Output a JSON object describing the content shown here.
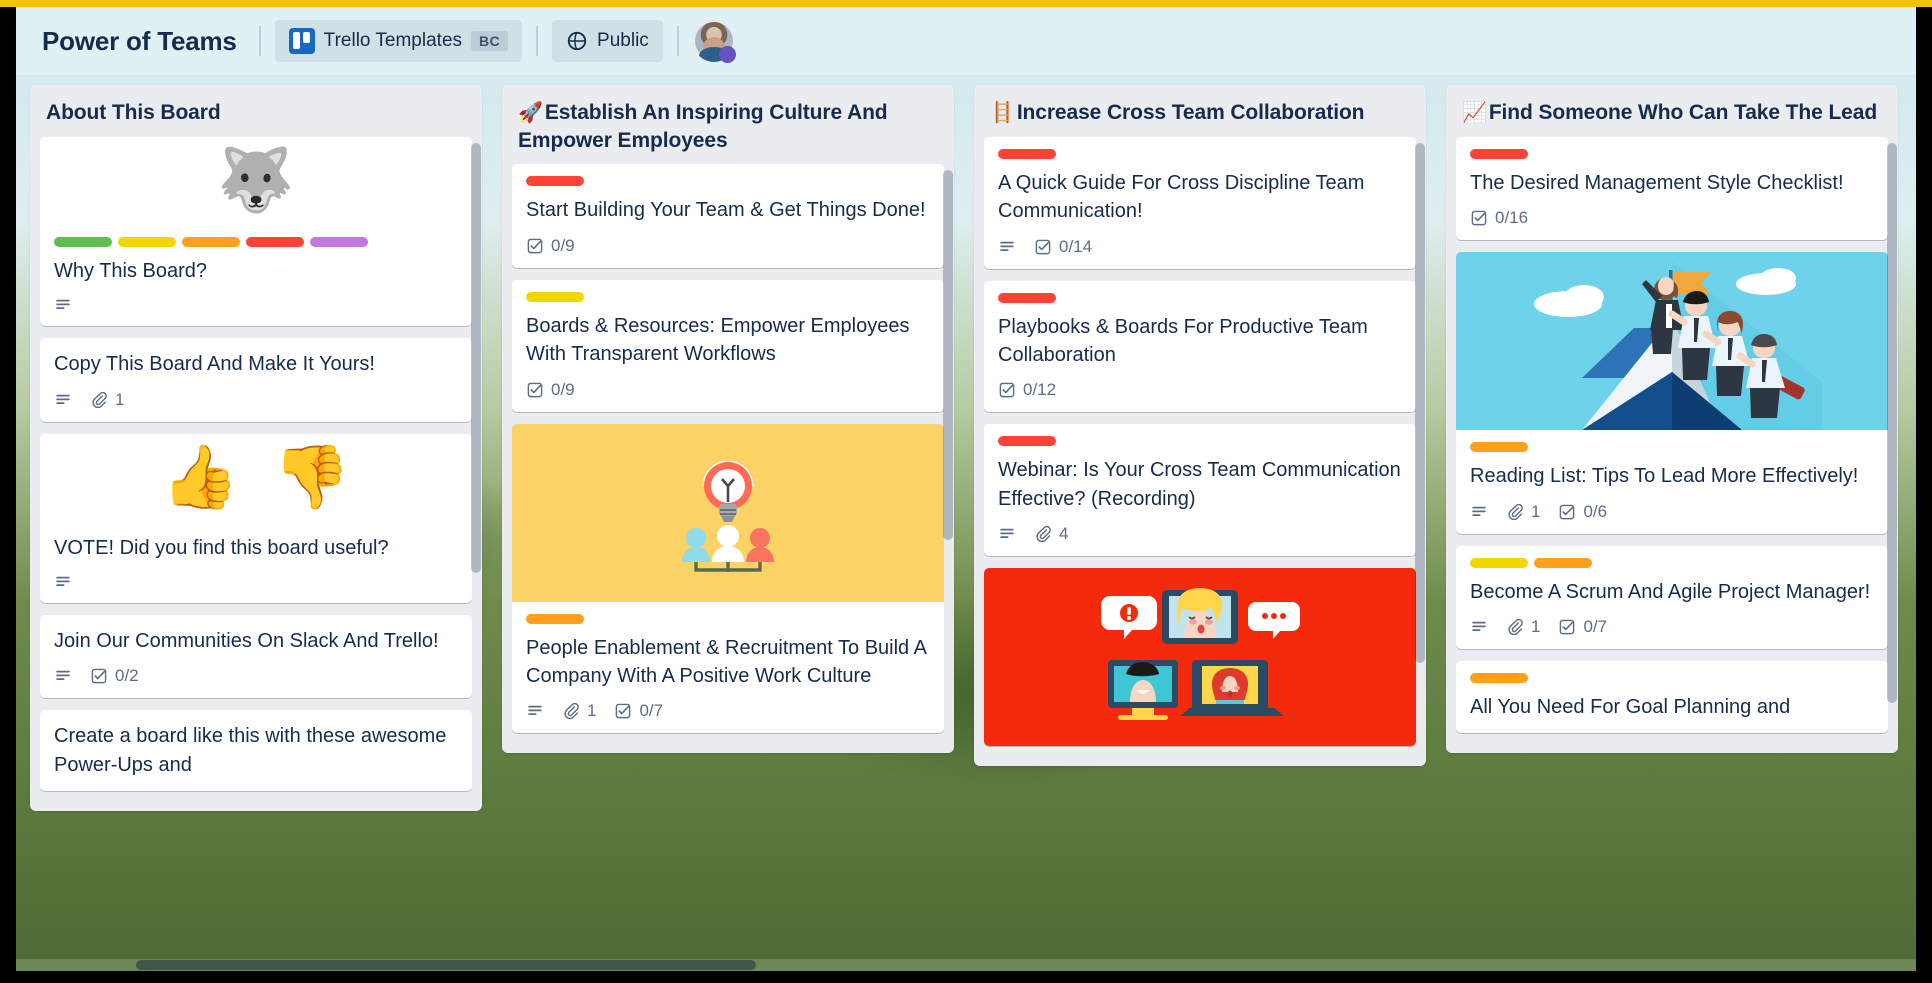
{
  "header": {
    "board_title": "Power of Teams",
    "workspace": {
      "label": "Trello Templates",
      "badge": "BC",
      "icon": "trello-logo-icon"
    },
    "visibility": {
      "label": "Public",
      "icon": "globe-icon"
    },
    "avatar": {
      "name": "member-avatar"
    }
  },
  "colors": {
    "green": "#61BD4F",
    "yellow": "#F2D600",
    "orange": "#FF9F1A",
    "red": "#FF4136",
    "purple": "#C377E0",
    "card_text": "#172B4D",
    "badge_text": "#5E6C84",
    "list_bg": "#EBECF0"
  },
  "lists": [
    {
      "name": "about-this-board",
      "emoji": "",
      "title": "About This Board",
      "cards": [
        {
          "name": "why-this-board",
          "cover": {
            "type": "emoji",
            "glyph": "🐺",
            "bg": "#FFFFFF"
          },
          "labels": [
            "green",
            "yellow",
            "orange",
            "red",
            "purple"
          ],
          "title": "Why This Board?",
          "badges": {
            "description": true,
            "attachments": null,
            "checklist": null
          }
        },
        {
          "name": "copy-this-board",
          "cover": null,
          "labels": [],
          "title": "Copy This Board And Make It Yours!",
          "badges": {
            "description": true,
            "attachments": "1",
            "checklist": null
          }
        },
        {
          "name": "vote-useful",
          "cover": {
            "type": "emoji-pair",
            "glyph": "👍👎",
            "bg": "#FFFFFF"
          },
          "labels": [],
          "title": "VOTE! Did you find this board useful?",
          "badges": {
            "description": true,
            "attachments": null,
            "checklist": null
          }
        },
        {
          "name": "join-communities",
          "cover": null,
          "labels": [],
          "title": "Join Our Communities On Slack And Trello!",
          "badges": {
            "description": true,
            "attachments": null,
            "checklist": "0/2"
          }
        },
        {
          "name": "create-a-board-powerups",
          "cover": null,
          "labels": [],
          "title": "Create a board like this with these awesome Power-Ups and",
          "badges": {
            "description": null,
            "attachments": null,
            "checklist": null
          }
        }
      ]
    },
    {
      "name": "establish-inspiring-culture",
      "emoji": "🚀",
      "title": "Establish An Inspiring Culture And Empower Employees",
      "cards": [
        {
          "name": "start-building-your-team",
          "cover": null,
          "labels": [
            "red"
          ],
          "title": "Start Building Your Team & Get Things Done!",
          "badges": {
            "description": null,
            "attachments": null,
            "checklist": "0/9"
          }
        },
        {
          "name": "boards-and-resources",
          "cover": null,
          "labels": [
            "yellow"
          ],
          "title": "Boards & Resources: Empower Employees With Transparent Workflows",
          "badges": {
            "description": null,
            "attachments": null,
            "checklist": "0/9"
          }
        },
        {
          "name": "people-enablement-recruitment",
          "cover": {
            "type": "image",
            "art": "lightbulb-team",
            "bg": "#FBD266"
          },
          "labels": [
            "orange"
          ],
          "title": "People Enablement & Recruitment To Build A Company With A Positive Work Culture",
          "badges": {
            "description": true,
            "attachments": "1",
            "checklist": "0/7"
          }
        }
      ]
    },
    {
      "name": "increase-cross-team-collaboration",
      "emoji": "🪜",
      "title": "Increase Cross Team Collaboration",
      "cards": [
        {
          "name": "quick-guide-cross-discipline",
          "cover": null,
          "labels": [
            "red"
          ],
          "title": "A Quick Guide For Cross Discipline Team Communication!",
          "badges": {
            "description": true,
            "attachments": null,
            "checklist": "0/14"
          }
        },
        {
          "name": "playbooks-and-boards",
          "cover": null,
          "labels": [
            "red"
          ],
          "title": "Playbooks & Boards For Productive Team Collaboration",
          "badges": {
            "description": null,
            "attachments": null,
            "checklist": "0/12"
          }
        },
        {
          "name": "webinar-cross-team-communication",
          "cover": null,
          "labels": [
            "red"
          ],
          "title": "Webinar: Is Your Cross Team Communication Effective? (Recording)",
          "badges": {
            "description": true,
            "attachments": "4",
            "checklist": null
          }
        },
        {
          "name": "video-call-card",
          "cover": {
            "type": "image",
            "art": "video-call",
            "bg": "#F52A0D"
          },
          "labels": [],
          "title": "",
          "badges": {
            "description": null,
            "attachments": null,
            "checklist": null
          }
        }
      ]
    },
    {
      "name": "find-someone-who-can-take-the-lead",
      "emoji": "📈",
      "title": "Find Someone Who Can Take The Lead",
      "cards": [
        {
          "name": "desired-management-style-checklist",
          "cover": null,
          "labels": [
            "red"
          ],
          "title": "The Desired Management Style Checklist!",
          "badges": {
            "description": null,
            "attachments": null,
            "checklist": "0/16"
          }
        },
        {
          "name": "reading-list-lead-more-effectively",
          "cover": {
            "type": "image",
            "art": "mountain-team",
            "bg": "#6ED2EA"
          },
          "labels": [
            "orange"
          ],
          "title": "Reading List: Tips To Lead More Effectively!",
          "badges": {
            "description": true,
            "attachments": "1",
            "checklist": "0/6"
          }
        },
        {
          "name": "become-scrum-agile-project-manager",
          "cover": null,
          "labels": [
            "yellow",
            "orange"
          ],
          "title": "Become A Scrum And Agile Project Manager!",
          "badges": {
            "description": true,
            "attachments": "1",
            "checklist": "0/7"
          }
        },
        {
          "name": "all-you-need-goal-planning",
          "cover": null,
          "labels": [
            "orange"
          ],
          "title": "All You Need For Goal Planning and",
          "badges": {
            "description": null,
            "attachments": null,
            "checklist": null
          }
        }
      ]
    }
  ]
}
